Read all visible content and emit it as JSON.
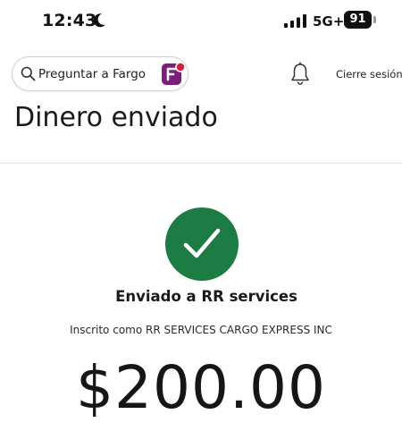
{
  "status_bar": {
    "time": "12:43",
    "network": "5G+",
    "battery": "91",
    "icons": [
      "moon-icon",
      "signal-icon"
    ]
  },
  "top_bar": {
    "search_placeholder": "Preguntar a Fargo",
    "bell_icon": "bell-icon",
    "signout_label": "Cierre sesión"
  },
  "page": {
    "title": "Dinero enviado"
  },
  "confirmation": {
    "icon": "check-icon",
    "sent_to": "Enviado a RR services",
    "enrolled_as": "Inscrito como RR SERVICES CARGO EXPRESS INC",
    "amount": "$200.00"
  },
  "colors": {
    "success_green": "#1c7c44",
    "fargo_purple": "#7a1f7a",
    "fargo_red": "#d71e3a"
  }
}
